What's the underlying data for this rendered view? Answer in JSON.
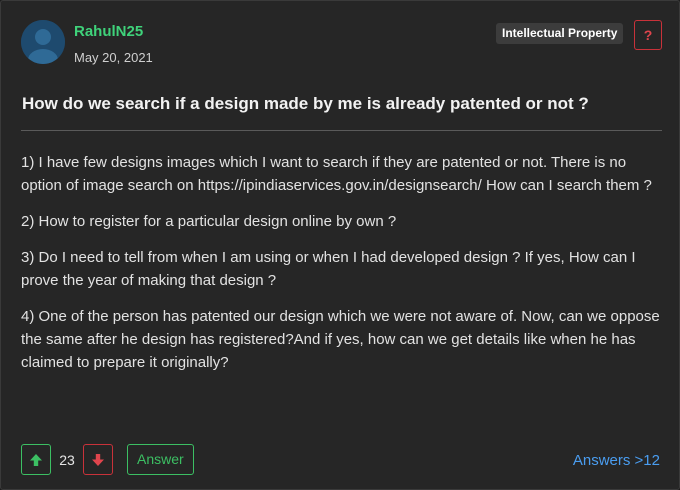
{
  "post": {
    "author": "RahulN25",
    "date": "May 20, 2021",
    "tag": "Intellectual Property",
    "report_label": "?",
    "title": "How do we search if a design made by me is already patented or not ?",
    "paragraphs": [
      "1) I have few designs images which I want to search if they are patented or not. There is no option of image search on https://ipindiaservices.gov.in/designsearch/ How can I search them ?",
      "2) How to register for a particular design online by own ?",
      "3) Do I need to tell from when I am using or when I had developed design ? If yes, How can I prove the year of making that design ?",
      "4) One of the person has patented our design which we were not aware of. Now, can we oppose the same after he design has registered?And if yes, how can we get details like when he has claimed to prepare it originally?"
    ]
  },
  "actions": {
    "vote_count": "23",
    "answer_label": "Answer",
    "answers_link": "Answers >12"
  },
  "colors": {
    "username": "#3fd27a",
    "upvote": "#3cbf63",
    "downvote": "#c9323a",
    "link": "#4a9df0",
    "tag_bg": "#3c3c3c"
  },
  "icons": [
    "avatar-icon",
    "arrow-up-icon",
    "arrow-down-icon",
    "question-icon"
  ]
}
